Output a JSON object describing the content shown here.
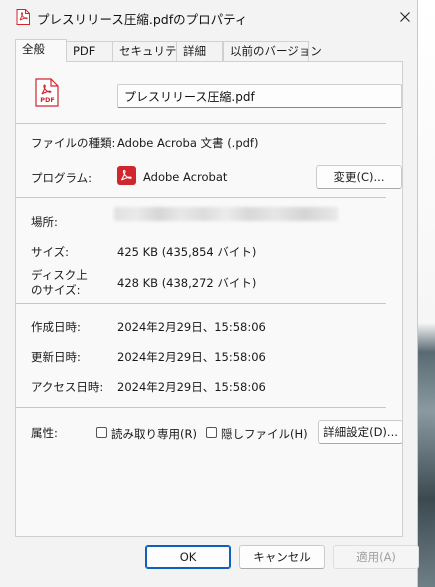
{
  "window": {
    "title": "プレスリリース圧縮.pdfのプロパティ"
  },
  "tabs": [
    {
      "label": "全般",
      "active": true
    },
    {
      "label": "PDF"
    },
    {
      "label": "セキュリティ"
    },
    {
      "label": "詳細"
    },
    {
      "label": "以前のバージョン"
    }
  ],
  "file": {
    "icon": "pdf-file-icon",
    "icon_text": "PDF",
    "name": "プレスリリース圧縮.pdf"
  },
  "type": {
    "label": "ファイルの種類:",
    "value": "Adobe Acroba 文書 (.pdf)"
  },
  "program": {
    "label": "プログラム:",
    "icon": "adobe-acrobat-icon",
    "value": "Adobe Acrobat",
    "change_button": "変更(C)..."
  },
  "location": {
    "label": "場所:"
  },
  "size": {
    "label": "サイズ:",
    "value": "425 KB (435,854 バイト)"
  },
  "disk_size": {
    "label_line1": "ディスク上",
    "label_line2": "のサイズ:",
    "value": "428 KB (438,272 バイト)"
  },
  "created": {
    "label": "作成日時:",
    "value": "2024年2月29日、15:58:06"
  },
  "modified": {
    "label": "更新日時:",
    "value": "2024年2月29日、15:58:06"
  },
  "accessed": {
    "label": "アクセス日時:",
    "value": "2024年2月29日、15:58:06"
  },
  "attributes": {
    "label": "属性:",
    "readonly": {
      "label": "読み取り専用(R)",
      "checked": false
    },
    "hidden": {
      "label": "隠しファイル(H)",
      "checked": false
    },
    "advanced_button": "詳細設定(D)..."
  },
  "footer": {
    "ok": "OK",
    "cancel": "キャンセル",
    "apply": "適用(A)"
  },
  "colors": {
    "accent": "#0f5fbf",
    "pdf_red": "#d0262e"
  }
}
